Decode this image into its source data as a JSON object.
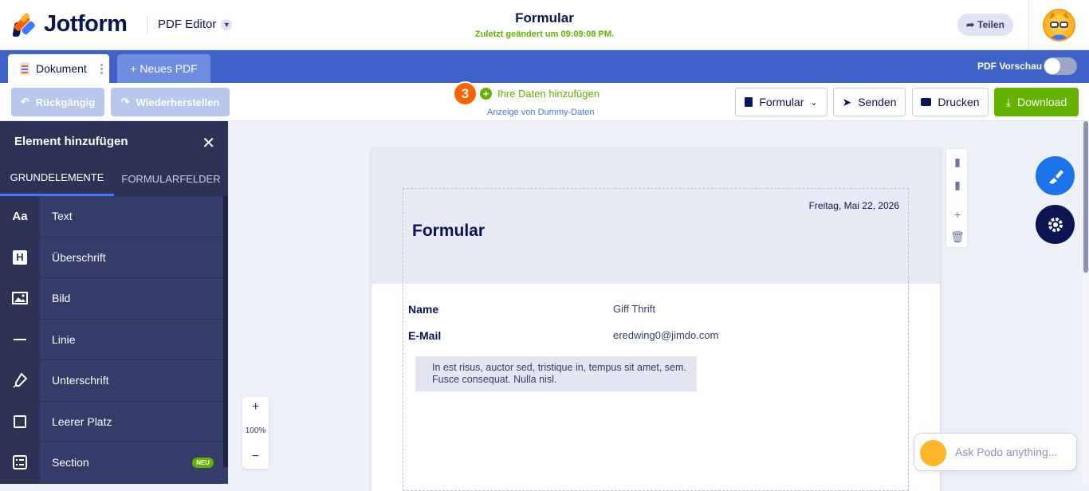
{
  "header": {
    "logo_text": "Jotform",
    "product": "PDF Editor",
    "title": "Formular",
    "subtitle": "Zuletzt geändert um 09:09:08 PM.",
    "share_label": "Teilen"
  },
  "tabs": {
    "document_label": "Dokument",
    "new_pdf_label": "+ Neues PDF",
    "pdf_preview_label": "PDF Vorschau"
  },
  "toolbar": {
    "undo_label": "Rückgängig",
    "redo_label": "Wiederherstellen",
    "step_badge": "3",
    "add_data_label": "Ihre Daten hinzufügen",
    "dummy_label": "Anzeige von Dummy-Daten",
    "form_select_label": "Formular",
    "send_label": "Senden",
    "print_label": "Drucken",
    "download_label": "Download"
  },
  "panel": {
    "title": "Element hinzufügen",
    "tab_basic": "GRUNDELEMENTE",
    "tab_fields": "FORMULARFELDER",
    "items": [
      {
        "label": "Text",
        "icon": "text-icon"
      },
      {
        "label": "Überschrift",
        "icon": "heading-icon"
      },
      {
        "label": "Bild",
        "icon": "image-icon"
      },
      {
        "label": "Linie",
        "icon": "line-icon"
      },
      {
        "label": "Unterschrift",
        "icon": "signature-icon"
      },
      {
        "label": "Leerer Platz",
        "icon": "blank-space-icon"
      },
      {
        "label": "Section",
        "icon": "section-icon",
        "badge": "NEU"
      }
    ]
  },
  "document": {
    "date": "Freitag, Mai 22, 2026",
    "title": "Formular",
    "fields": [
      {
        "label": "Name",
        "value": "Giff Thrift"
      },
      {
        "label": "E-Mail",
        "value": "eredwing0@jimdo.com"
      }
    ],
    "note": "In est risus, auctor sed, tristique in, tempus sit amet, sem. Fusce consequat. Nulla nisl."
  },
  "zoom": {
    "level": "100%",
    "plus": "+",
    "minus": "−"
  },
  "podo": {
    "placeholder": "Ask Podo anything..."
  },
  "colors": {
    "brand_blue": "#3e62c8",
    "accent_green": "#64b200",
    "orange": "#ff6100",
    "dark_navy": "#0a1551"
  }
}
